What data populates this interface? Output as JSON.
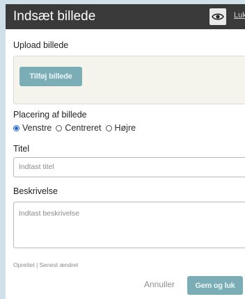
{
  "dialog": {
    "title": "Indsæt billede",
    "close_label": "Luk",
    "preview_icon": "eye-icon"
  },
  "upload": {
    "label": "Upload billede",
    "button_label": "Tilføj billede"
  },
  "placement": {
    "label": "Placering af billede",
    "options": [
      "Venstre",
      "Centreret",
      "Højre"
    ],
    "selected": "Venstre"
  },
  "title_field": {
    "label": "Titel",
    "placeholder": "Indtast titel"
  },
  "description_field": {
    "label": "Beskrivelse",
    "placeholder": "Indtast beskrivelse"
  },
  "meta": {
    "text": "Oprettet | Senest ændret"
  },
  "footer": {
    "cancel_label": "Annuller",
    "save_label": "Gem og luk"
  },
  "colors": {
    "header_bg": "#3a3a3a",
    "button_bg": "#7aadb6",
    "radio_selected": "#1a5fd4"
  }
}
